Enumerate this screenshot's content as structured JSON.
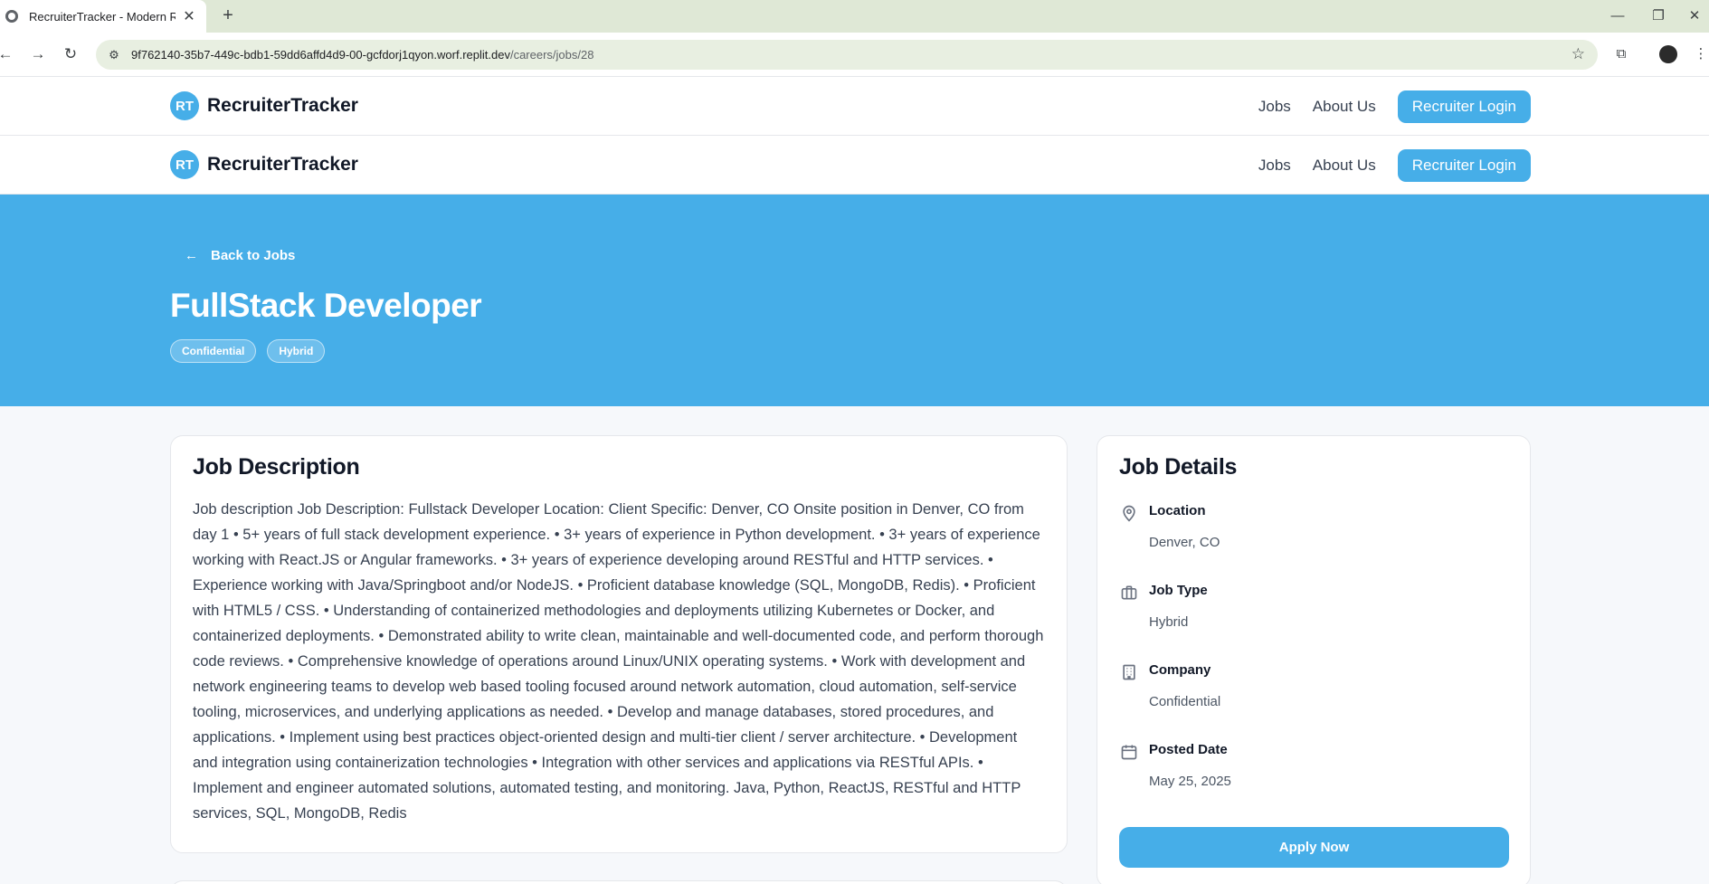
{
  "browser": {
    "tab_title": "RecruiterTracker - Modern Recru",
    "tab_close": "✕",
    "new_tab": "+",
    "url_host": "9f762140-35b7-449c-bdb1-59dd6affd4d9-00-gcfdorj1qyon.worf.replit.dev",
    "url_path": "/careers/jobs/28",
    "icons": [
      "back-icon",
      "forward-icon",
      "reload-icon",
      "site-info-icon",
      "star-icon",
      "search-tab-icon",
      "profile-avatar",
      "menu-icon"
    ]
  },
  "header": {
    "logo_text": "RT",
    "brand_name": "RecruiterTracker",
    "nav": {
      "jobs": "Jobs",
      "about": "About Us"
    },
    "login_label": "Recruiter Login"
  },
  "hero": {
    "back_label": "Back to Jobs",
    "title": "FullStack Developer",
    "tags": [
      "Confidential",
      "Hybrid"
    ]
  },
  "description": {
    "heading": "Job Description",
    "text": "Job description Job Description: Fullstack Developer Location: Client Specific: Denver, CO Onsite position in Denver, CO from day 1 • 5+ years of full stack development experience. • 3+ years of experience in Python development. • 3+ years of experience working with React.JS or Angular frameworks. • 3+ years of experience developing around RESTful and HTTP services. • Experience working with Java/Springboot and/or NodeJS. • Proficient database knowledge (SQL, MongoDB, Redis). • Proficient with HTML5 / CSS. • Understanding of containerized methodologies and deployments utilizing Kubernetes or Docker, and containerized deployments. • Demonstrated ability to write clean, maintainable and well-documented code, and perform thorough code reviews. • Comprehensive knowledge of operations around Linux/UNIX operating systems. • Work with development and network engineering teams to develop web based tooling focused around network automation, cloud automation, self-service tooling, microservices, and underlying applications as needed. • Develop and manage databases, stored procedures, and applications. • Implement using best practices object-oriented design and multi-tier client / server architecture. • Development and integration using containerization technologies • Integration with other services and applications via RESTful APIs. • Implement and engineer automated solutions, automated testing, and monitoring. Java, Python, ReactJS, RESTful and HTTP services, SQL, MongoDB, Redis"
  },
  "details": {
    "heading": "Job Details",
    "items": [
      {
        "label": "Location",
        "value": "Denver, CO",
        "icon": "map-pin-icon"
      },
      {
        "label": "Job Type",
        "value": "Hybrid",
        "icon": "briefcase-icon"
      },
      {
        "label": "Company",
        "value": "Confidential",
        "icon": "building-icon"
      },
      {
        "label": "Posted Date",
        "value": "May 25, 2025",
        "icon": "calendar-icon"
      }
    ],
    "apply_label": "Apply Now"
  },
  "colors": {
    "accent": "#46aee8",
    "page_bg": "#f6f8fb",
    "tabbar_bg": "#dfe8d6"
  }
}
